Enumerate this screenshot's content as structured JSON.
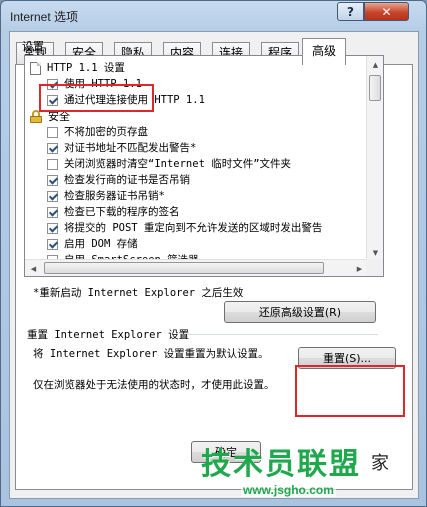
{
  "window": {
    "title": "Internet 选项",
    "help_label": "?",
    "close_label": "✕"
  },
  "tabs": [
    {
      "label": "常规"
    },
    {
      "label": "安全"
    },
    {
      "label": "隐私"
    },
    {
      "label": "内容"
    },
    {
      "label": "连接"
    },
    {
      "label": "程序"
    },
    {
      "label": "高级",
      "active": true
    }
  ],
  "settings": {
    "group_label": "设置",
    "items": [
      {
        "type": "page",
        "label": "HTTP 1.1 设置"
      },
      {
        "type": "checkbox",
        "checked": true,
        "label": "使用 HTTP 1.1"
      },
      {
        "type": "checkbox",
        "checked": true,
        "label": "通过代理连接使用 HTTP 1.1"
      },
      {
        "type": "lock",
        "label": "安全"
      },
      {
        "type": "checkbox",
        "checked": false,
        "label": "不将加密的页存盘"
      },
      {
        "type": "checkbox",
        "checked": true,
        "label": "对证书地址不匹配发出警告*"
      },
      {
        "type": "checkbox",
        "checked": false,
        "label": "关闭浏览器时清空“Internet 临时文件”文件夹"
      },
      {
        "type": "checkbox",
        "checked": true,
        "label": "检查发行商的证书是否吊销"
      },
      {
        "type": "checkbox",
        "checked": true,
        "label": "检查服务器证书吊销*"
      },
      {
        "type": "checkbox",
        "checked": true,
        "label": "检查已下载的程序的签名"
      },
      {
        "type": "checkbox",
        "checked": true,
        "label": "将提交的 POST 重定向到不允许发送的区域时发出警告"
      },
      {
        "type": "checkbox",
        "checked": true,
        "label": "启用 DOM 存储"
      },
      {
        "type": "checkbox",
        "checked": false,
        "label": "启用 SmartScreen 筛选器"
      }
    ],
    "note": "*重新启动 Internet Explorer 之后生效",
    "restore_label": "还原高级设置(R)"
  },
  "reset": {
    "section_title": "重置 Internet Explorer 设置",
    "description": "将 Internet Explorer 设置重置为默认设置。",
    "button_label": "重置(S)...",
    "hint": "仅在浏览器处于无法使用的状态时，才使用此设置。"
  },
  "footer": {
    "ok_label": "确定"
  },
  "watermark": {
    "brand": "技术员联盟",
    "url": "www.jsgho.com",
    "suffix": "家"
  },
  "colors": {
    "highlight": "#e0262a",
    "watermark": "#1fa84c"
  }
}
